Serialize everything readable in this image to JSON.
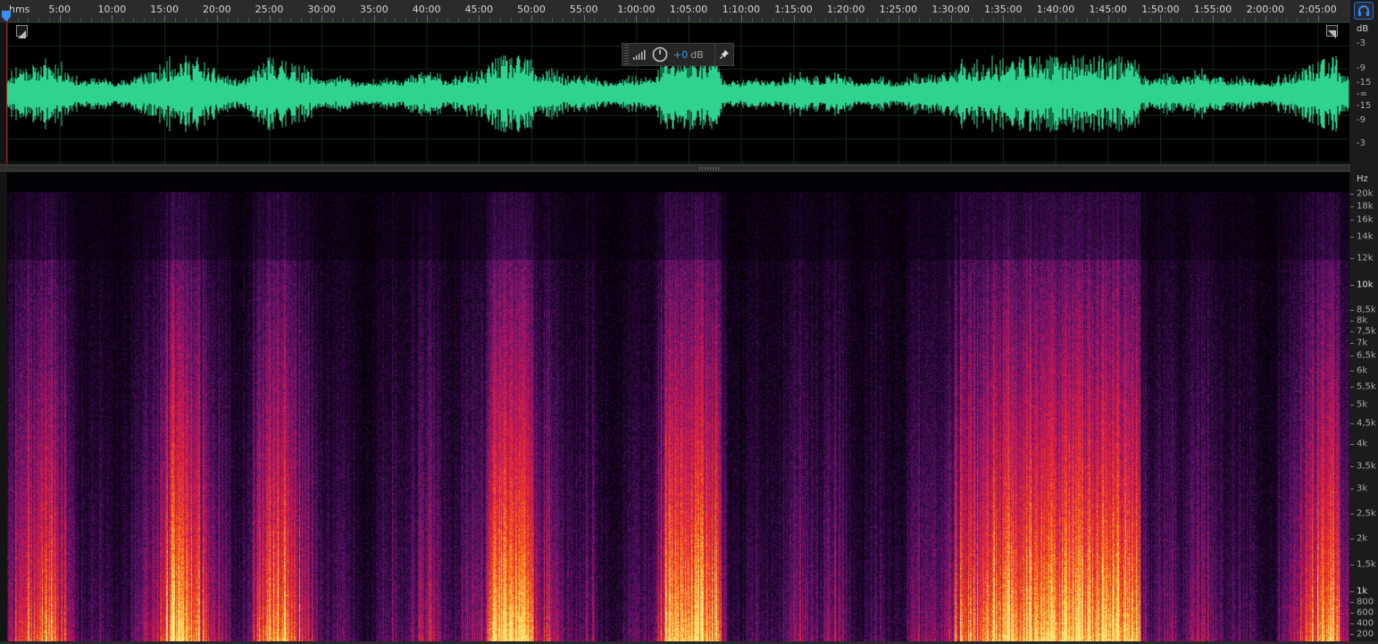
{
  "ruler": {
    "unit_label": "hms",
    "time_labels": [
      "5:00",
      "10:00",
      "15:00",
      "20:00",
      "25:00",
      "30:00",
      "35:00",
      "40:00",
      "45:00",
      "50:00",
      "55:00",
      "1:00:00",
      "1:05:00",
      "1:10:00",
      "1:15:00",
      "1:20:00",
      "1:25:00",
      "1:30:00",
      "1:35:00",
      "1:40:00",
      "1:45:00",
      "1:50:00",
      "1:55:00",
      "2:00:00",
      "2:05:00"
    ]
  },
  "waveform": {
    "color": "#2fd38f",
    "gain": {
      "value": "+0",
      "unit": "dB"
    },
    "db_scale": {
      "unit": "dB",
      "labels": [
        "-3",
        "-9",
        "-15",
        "-∞",
        "-15",
        "-9",
        "-3"
      ]
    }
  },
  "spectrogram": {
    "hz_unit": "Hz",
    "hz_labels": [
      "20k",
      "18k",
      "16k",
      "14k",
      "12k",
      "10k",
      "8,5k",
      "8k",
      "7,5k",
      "7k",
      "6,5k",
      "6k",
      "5,5k",
      "5k",
      "4,5k",
      "4k",
      "3,5k",
      "3k",
      "2,5k",
      "2k",
      "1,5k",
      "1k",
      "800",
      "600",
      "400",
      "200"
    ],
    "hz_major": [
      "10k",
      "1k"
    ]
  },
  "icons": {
    "playhead": "playhead-marker-icon",
    "corner": "headphones-icon",
    "meter": "level-meter-icon",
    "knob": "power-knob-icon",
    "pin": "pin-icon"
  },
  "colors": {
    "accent": "#1e6fd8",
    "gain_value": "#3d9be9"
  }
}
